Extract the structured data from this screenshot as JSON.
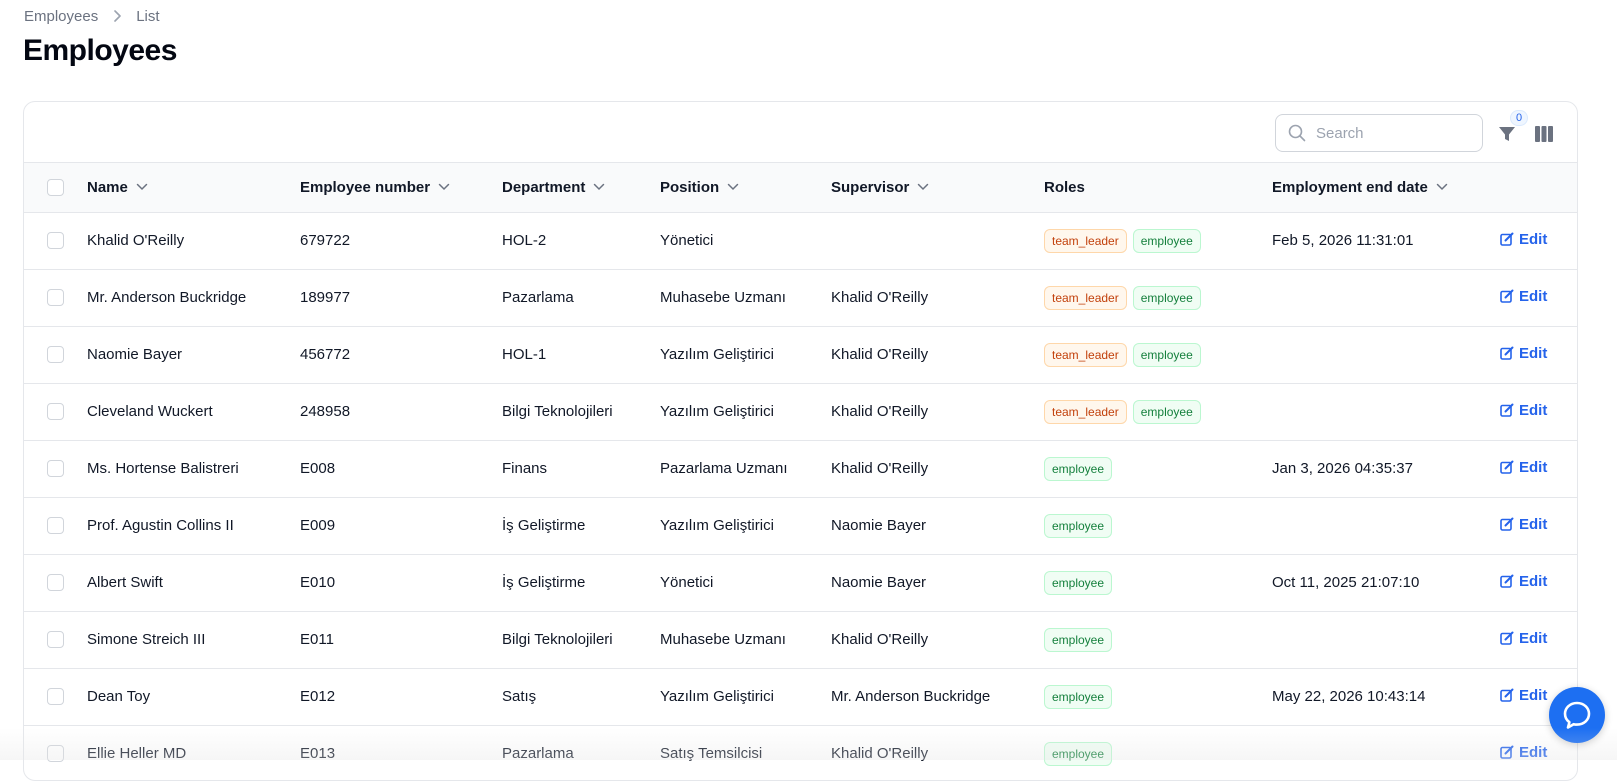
{
  "breadcrumb": {
    "items": [
      "Employees",
      "List"
    ]
  },
  "page": {
    "title": "Employees"
  },
  "toolbar": {
    "search_placeholder": "Search",
    "filter_count": "0"
  },
  "table": {
    "columns": [
      "Name",
      "Employee number",
      "Department",
      "Position",
      "Supervisor",
      "Roles",
      "Employment end date"
    ],
    "edit_label": "Edit",
    "rows": [
      {
        "name": "Khalid O'Reilly",
        "number": "679722",
        "department": "HOL-2",
        "position": "Yönetici",
        "supervisor": "",
        "roles": [
          "team_leader",
          "employee"
        ],
        "end_date": "Feb 5, 2026 11:31:01"
      },
      {
        "name": "Mr. Anderson Buckridge",
        "number": "189977",
        "department": "Pazarlama",
        "position": "Muhasebe Uzmanı",
        "supervisor": "Khalid O'Reilly",
        "roles": [
          "team_leader",
          "employee"
        ],
        "end_date": ""
      },
      {
        "name": "Naomie Bayer",
        "number": "456772",
        "department": "HOL-1",
        "position": "Yazılım Geliştirici",
        "supervisor": "Khalid O'Reilly",
        "roles": [
          "team_leader",
          "employee"
        ],
        "end_date": ""
      },
      {
        "name": "Cleveland Wuckert",
        "number": "248958",
        "department": "Bilgi Teknolojileri",
        "position": "Yazılım Geliştirici",
        "supervisor": "Khalid O'Reilly",
        "roles": [
          "team_leader",
          "employee"
        ],
        "end_date": ""
      },
      {
        "name": "Ms. Hortense Balistreri",
        "number": "E008",
        "department": "Finans",
        "position": "Pazarlama Uzmanı",
        "supervisor": "Khalid O'Reilly",
        "roles": [
          "employee"
        ],
        "end_date": "Jan 3, 2026 04:35:37"
      },
      {
        "name": "Prof. Agustin Collins II",
        "number": "E009",
        "department": "İş Geliştirme",
        "position": "Yazılım Geliştirici",
        "supervisor": "Naomie Bayer",
        "roles": [
          "employee"
        ],
        "end_date": ""
      },
      {
        "name": "Albert Swift",
        "number": "E010",
        "department": "İş Geliştirme",
        "position": "Yönetici",
        "supervisor": "Naomie Bayer",
        "roles": [
          "employee"
        ],
        "end_date": "Oct 11, 2025 21:07:10"
      },
      {
        "name": "Simone Streich III",
        "number": "E011",
        "department": "Bilgi Teknolojileri",
        "position": "Muhasebe Uzmanı",
        "supervisor": "Khalid O'Reilly",
        "roles": [
          "employee"
        ],
        "end_date": ""
      },
      {
        "name": "Dean Toy",
        "number": "E012",
        "department": "Satış",
        "position": "Yazılım Geliştirici",
        "supervisor": "Mr. Anderson Buckridge",
        "roles": [
          "employee"
        ],
        "end_date": "May 22, 2026 10:43:14"
      },
      {
        "name": "Ellie Heller MD",
        "number": "E013",
        "department": "Pazarlama",
        "position": "Satış Temsilcisi",
        "supervisor": "Khalid O'Reilly",
        "roles": [
          "employee"
        ],
        "end_date": ""
      }
    ]
  },
  "colors": {
    "accent": "#2563eb",
    "team_leader": "#c2410c",
    "employee": "#15803d",
    "chat_button": "#1d6ff2"
  },
  "icons": {
    "search": "search-icon",
    "filter": "filter-icon",
    "columns": "columns-icon",
    "edit": "edit-icon",
    "sort": "chevron-down-icon",
    "chat": "chat-icon",
    "breadcrumb_separator": "chevron-right-icon"
  }
}
